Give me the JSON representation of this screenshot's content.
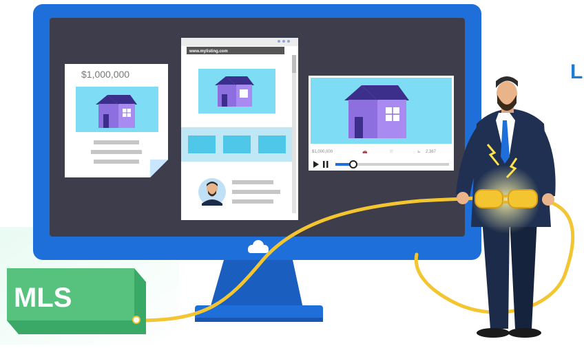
{
  "flyer": {
    "price": "$1,000,000"
  },
  "browser": {
    "url": "www.mylisting.com"
  },
  "video": {
    "price": "$1,000,000",
    "stat_count": "2,367"
  },
  "mls_box": {
    "label": "MLS"
  },
  "headline_fragment": "L",
  "colors": {
    "monitor_blue": "#1e6fd9",
    "screen_dark": "#3d3d4c",
    "sky": "#7fdcf5",
    "house_purple": "#8e6fe0",
    "roof_dark": "#3c2f8c",
    "cable_yellow": "#f3c531",
    "mls_green": "#56c27e",
    "suit_navy": "#1c2b4a"
  }
}
